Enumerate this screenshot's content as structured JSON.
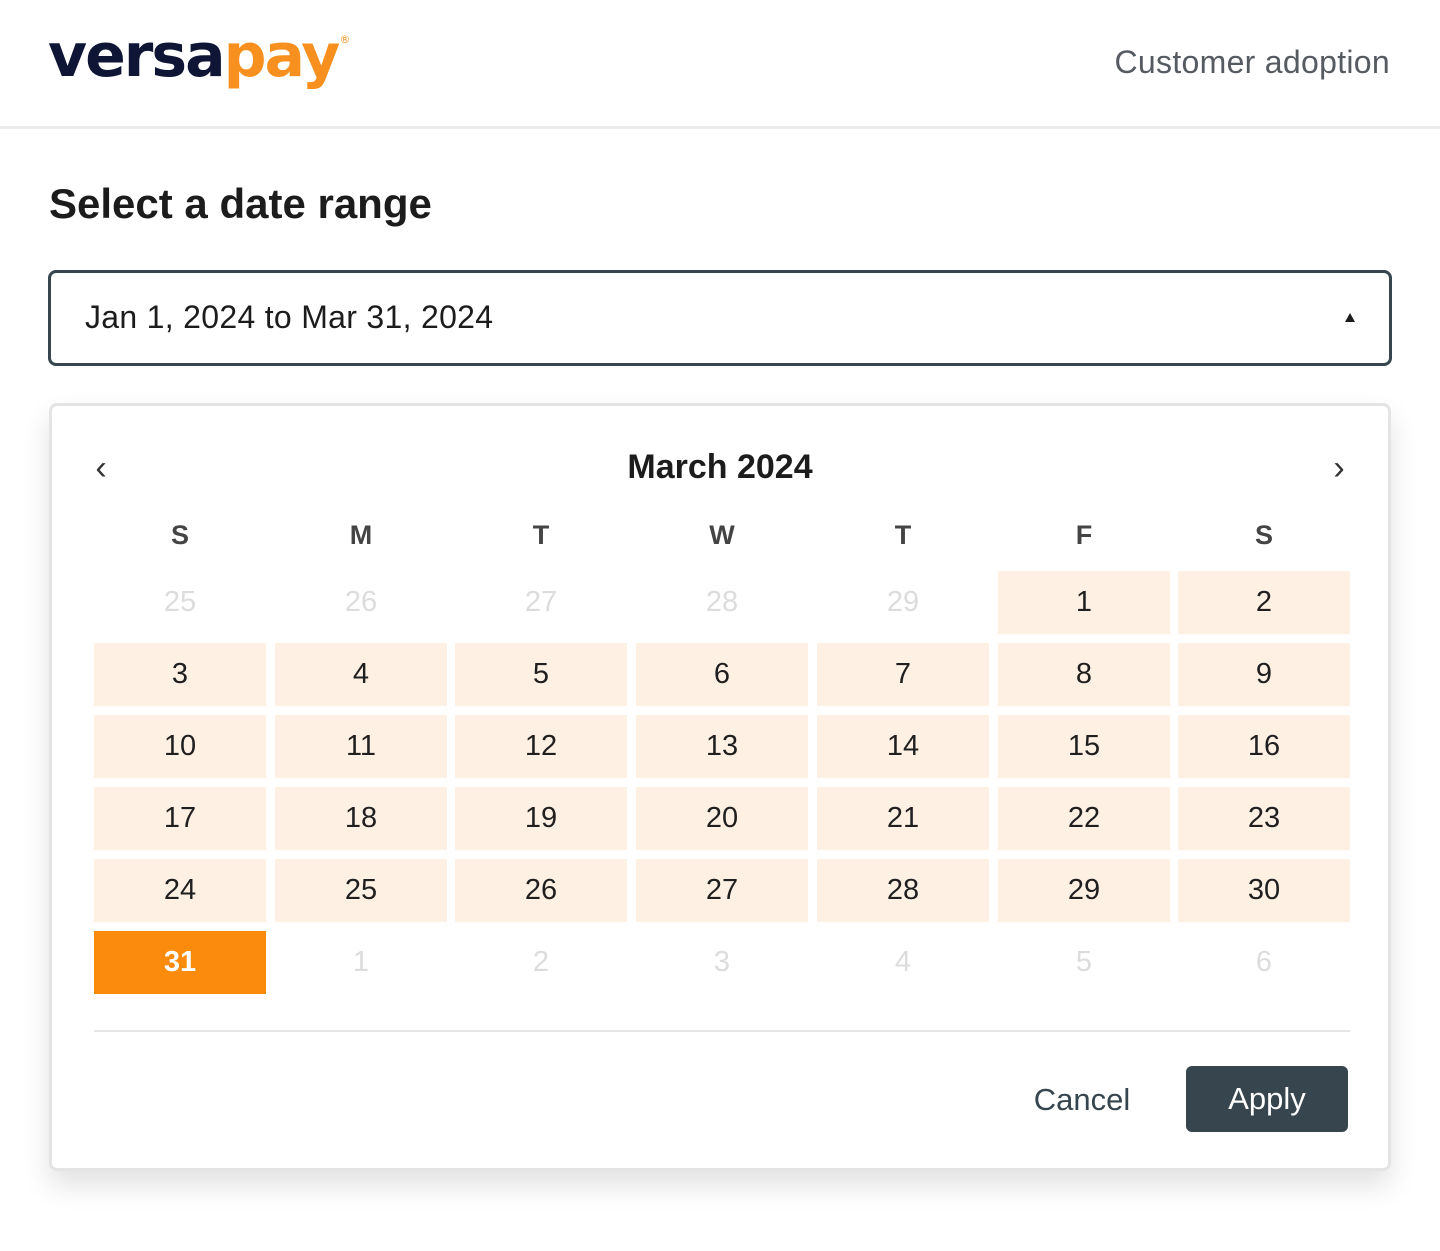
{
  "header": {
    "logo_primary": "versa",
    "logo_accent": "pay",
    "logo_mark": "®",
    "link_label": "Customer adoption"
  },
  "page": {
    "title": "Select a date range"
  },
  "date_range_input": {
    "value": "Jan 1, 2024 to Mar 31, 2024",
    "caret_icon": "caret-up-icon"
  },
  "calendar": {
    "prev_label": "‹",
    "next_label": "›",
    "month_label": "March 2024",
    "weekdays": [
      "S",
      "M",
      "T",
      "W",
      "T",
      "F",
      "S"
    ],
    "weeks": [
      [
        {
          "label": "25",
          "state": "outside"
        },
        {
          "label": "26",
          "state": "outside"
        },
        {
          "label": "27",
          "state": "outside"
        },
        {
          "label": "28",
          "state": "outside"
        },
        {
          "label": "29",
          "state": "outside"
        },
        {
          "label": "1",
          "state": "in-range"
        },
        {
          "label": "2",
          "state": "in-range"
        }
      ],
      [
        {
          "label": "3",
          "state": "in-range"
        },
        {
          "label": "4",
          "state": "in-range"
        },
        {
          "label": "5",
          "state": "in-range"
        },
        {
          "label": "6",
          "state": "in-range"
        },
        {
          "label": "7",
          "state": "in-range"
        },
        {
          "label": "8",
          "state": "in-range"
        },
        {
          "label": "9",
          "state": "in-range"
        }
      ],
      [
        {
          "label": "10",
          "state": "in-range"
        },
        {
          "label": "11",
          "state": "in-range"
        },
        {
          "label": "12",
          "state": "in-range"
        },
        {
          "label": "13",
          "state": "in-range"
        },
        {
          "label": "14",
          "state": "in-range"
        },
        {
          "label": "15",
          "state": "in-range"
        },
        {
          "label": "16",
          "state": "in-range"
        }
      ],
      [
        {
          "label": "17",
          "state": "in-range"
        },
        {
          "label": "18",
          "state": "in-range"
        },
        {
          "label": "19",
          "state": "in-range"
        },
        {
          "label": "20",
          "state": "in-range"
        },
        {
          "label": "21",
          "state": "in-range"
        },
        {
          "label": "22",
          "state": "in-range"
        },
        {
          "label": "23",
          "state": "in-range"
        }
      ],
      [
        {
          "label": "24",
          "state": "in-range"
        },
        {
          "label": "25",
          "state": "in-range"
        },
        {
          "label": "26",
          "state": "in-range"
        },
        {
          "label": "27",
          "state": "in-range"
        },
        {
          "label": "28",
          "state": "in-range"
        },
        {
          "label": "29",
          "state": "in-range"
        },
        {
          "label": "30",
          "state": "in-range"
        }
      ],
      [
        {
          "label": "31",
          "state": "selected"
        },
        {
          "label": "1",
          "state": "outside"
        },
        {
          "label": "2",
          "state": "outside"
        },
        {
          "label": "3",
          "state": "outside"
        },
        {
          "label": "4",
          "state": "outside"
        },
        {
          "label": "5",
          "state": "outside"
        },
        {
          "label": "6",
          "state": "outside"
        }
      ]
    ]
  },
  "actions": {
    "cancel_label": "Cancel",
    "apply_label": "Apply"
  },
  "colors": {
    "brand_navy": "#0f1535",
    "brand_orange": "#f7901e",
    "selected_day": "#fb8b0c",
    "range_fill": "#fef0e3",
    "primary_button": "#36454e"
  }
}
